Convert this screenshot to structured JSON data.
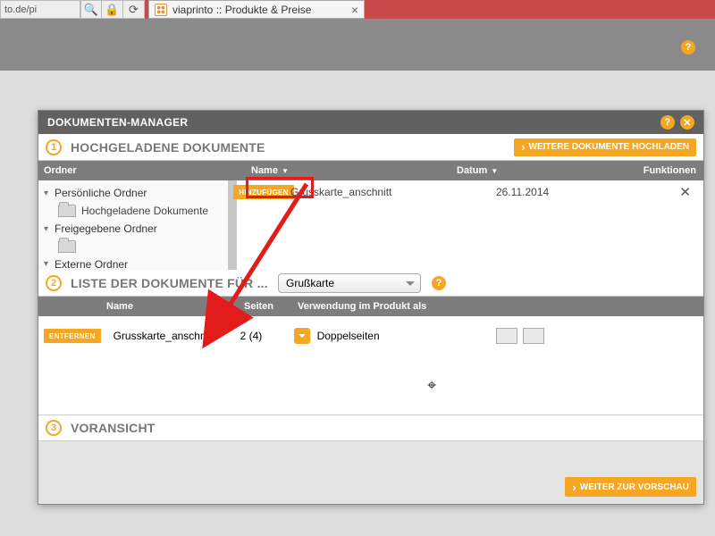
{
  "browser": {
    "url_fragment": "to.de/pi",
    "tab_title": "viaprinto :: Produkte & Preise"
  },
  "modal": {
    "title": "DOKUMENTEN-MANAGER"
  },
  "section1": {
    "title": "HOCHGELADENE DOKUMENTE",
    "upload_button": "WEITERE DOKUMENTE HOCHLADEN",
    "columns": {
      "folder": "Ordner",
      "name": "Name",
      "date": "Datum",
      "functions": "Funktionen"
    },
    "tree": {
      "personal": "Persönliche Ordner",
      "uploaded": "Hochgeladene Dokumente",
      "shared": "Freigegebene Ordner",
      "external": "Externe Ordner"
    },
    "doc": {
      "add_button": "HINZUFÜGEN",
      "name": "Grusskarte_anschnitt",
      "date": "26.11.2014"
    }
  },
  "section2": {
    "title": "LISTE DER DOKUMENTE FÜR ...",
    "product_select": "Grußkarte",
    "columns": {
      "name": "Name",
      "pages": "Seiten",
      "usage": "Verwendung im Produkt als"
    },
    "row": {
      "remove_button": "ENTFERNEN",
      "name": "Grusskarte_anschnitt",
      "pages": "2 (4)",
      "usage": "Doppelseiten"
    }
  },
  "section3": {
    "title": "VORANSICHT",
    "next_button": "WEITER ZUR VORSCHAU"
  }
}
